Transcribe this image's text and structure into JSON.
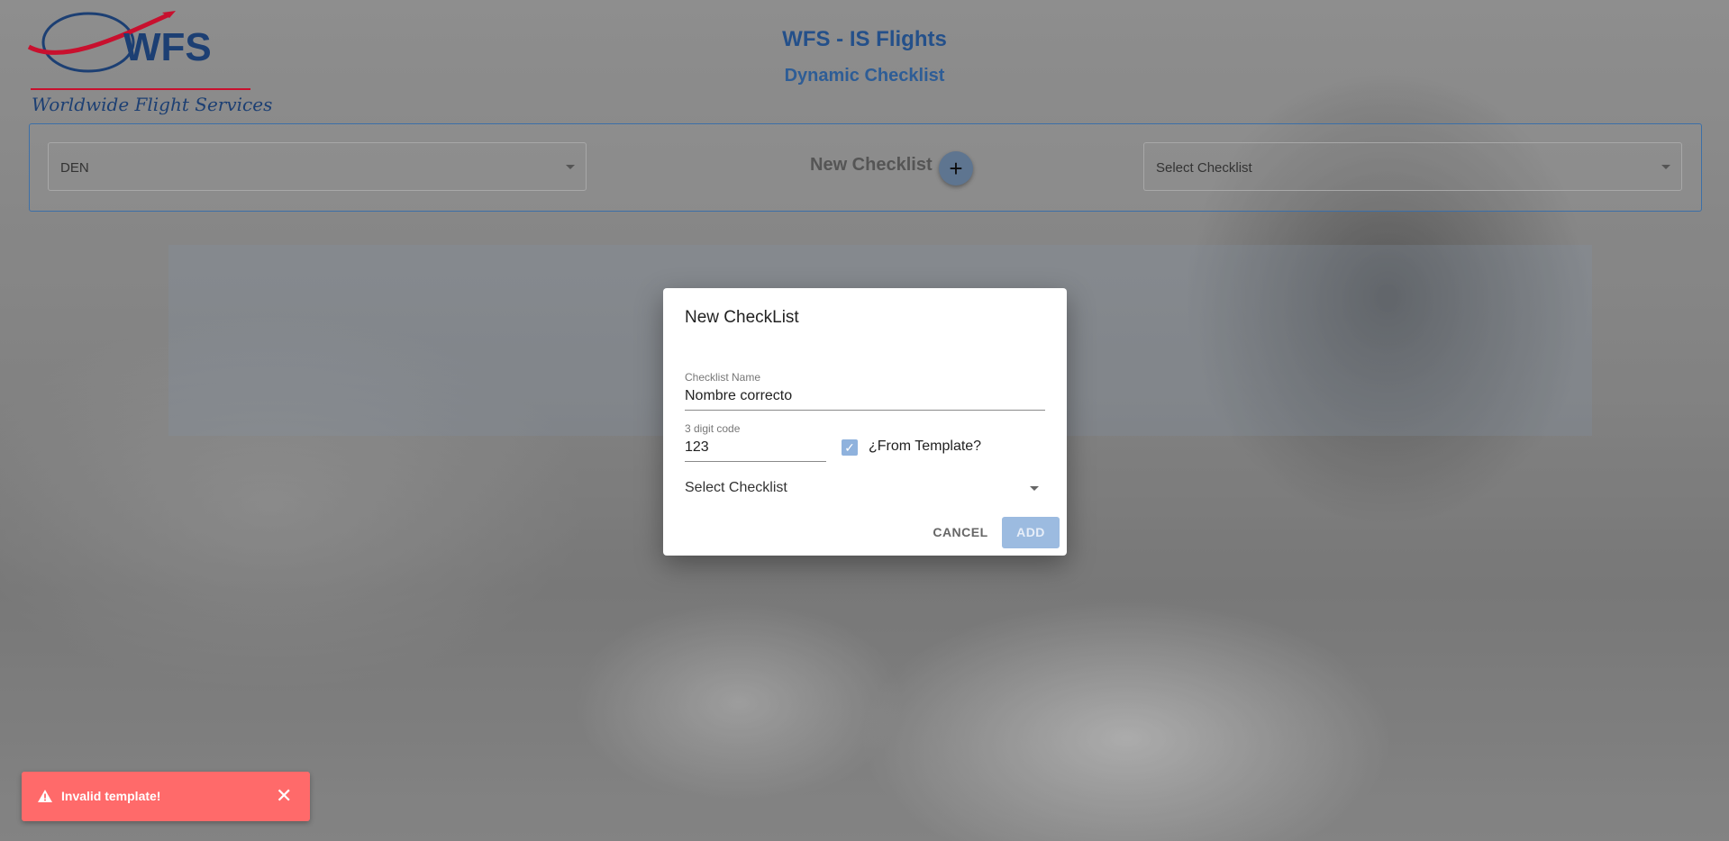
{
  "header": {
    "logo_tagline": "Worldwide Flight Services",
    "logo_mark": "WFS",
    "title": "WFS - IS Flights",
    "subtitle": "Dynamic Checklist"
  },
  "toolbar": {
    "station_value": "DEN",
    "new_checklist_label": "New Checklist",
    "add_button_glyph": "+",
    "checklist_select_value": "Select Checklist"
  },
  "dialog": {
    "title": "New CheckList",
    "name_label": "Checklist Name",
    "name_value": "Nombre correcto",
    "code_label": "3 digit code",
    "code_value": "123",
    "from_template_label": "¿From Template?",
    "from_template_checked": true,
    "select_value": "Select Checklist",
    "cancel_label": "CANCEL",
    "add_label": "ADD"
  },
  "toast": {
    "message": "Invalid template!",
    "icon": "warning-icon",
    "color": "#ff6a6a"
  },
  "colors": {
    "brand_blue": "#24508a",
    "brand_red": "#c8102e",
    "button_disabled": "#9cbbe0"
  }
}
